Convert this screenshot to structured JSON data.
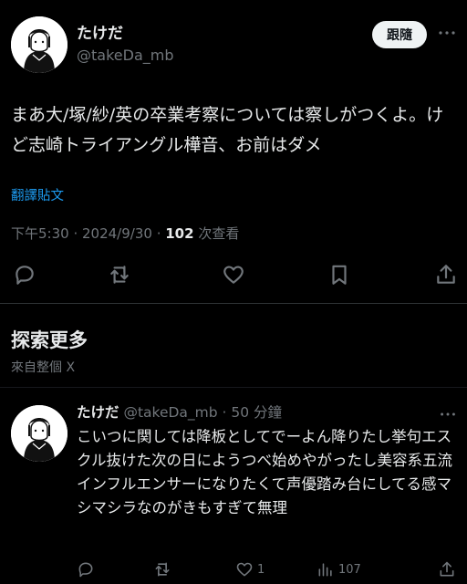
{
  "tweet": {
    "author_name": "たけだ",
    "author_handle": "@takeDa_mb",
    "follow_label": "跟隨",
    "text": "まあ大/塚/紗/英の卒業考察については察しがつくよ。けど志崎トライアングル樺音、お前はダメ",
    "translate_label": "翻譯貼文",
    "time": "下午5:30",
    "date": "2024/9/30",
    "separator": " · ",
    "views_count": "102",
    "views_label": " 次查看"
  },
  "explore": {
    "title": "探索更多",
    "subtitle": "來自整個 X"
  },
  "recommended": {
    "author_name": "たけだ",
    "author_handle": "@takeDa_mb",
    "time_ago": "50 分鐘",
    "text": "こいつに関しては降板としてでーよん降りたし挙句エスクル抜けた次の日にようつべ始めやがったし美容系五流インフルエンサーになりたくて声優踏み台にしてる感マシマシラなのがきもすぎて無理",
    "like_count": "1",
    "view_count": "107"
  },
  "icons": {
    "reply": "reply-icon",
    "retweet": "retweet-icon",
    "like": "heart-icon",
    "bookmark": "bookmark-icon",
    "share": "share-icon",
    "views": "views-icon",
    "more": "more-icon"
  },
  "colors": {
    "background": "#000000",
    "text": "#e7e9ea",
    "secondary": "#71767b",
    "link": "#1d9bf0",
    "follow_bg": "#eff3f4",
    "divider": "#2f3336"
  }
}
